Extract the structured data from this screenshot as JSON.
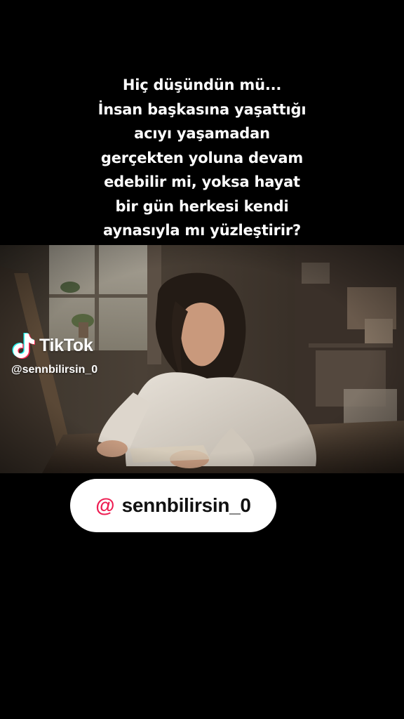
{
  "caption": {
    "lines": [
      "Hiç düşündün mü...",
      "İnsan başkasına yaşattığı",
      "acıyı yaşamadan",
      "gerçekten yoluna devam",
      "edebilir mi, yoksa hayat",
      "bir gün herkesi kendi",
      "aynasıyla mı yüzleştirir?"
    ]
  },
  "watermark": {
    "brand": "TikTok",
    "handle": "@sennbilirsin_0",
    "icon": "tiktok-note-icon"
  },
  "handle_pill": {
    "at_symbol": "@",
    "username": "sennbilirsin_0",
    "accent_color": "#ee1d52"
  },
  "colors": {
    "background": "#000000",
    "caption_text": "#ffffff",
    "pill_background": "#ffffff"
  }
}
